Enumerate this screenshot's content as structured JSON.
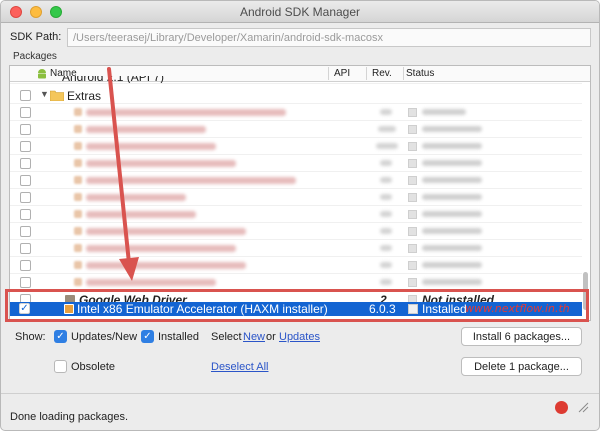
{
  "window": {
    "title": "Android SDK Manager"
  },
  "sdk_path": {
    "label": "SDK Path:",
    "value": "/Users/teerasej/Library/Developer/Xamarin/android-sdk-macosx"
  },
  "packages": {
    "section_label": "Packages",
    "columns": {
      "name": "Name",
      "api": "API",
      "rev": "Rev.",
      "status": "Status"
    },
    "partial_row": {
      "name": "Android 2.1 (API 7)"
    },
    "extras_row": {
      "name": "Extras"
    },
    "google_web_driver": {
      "name": "Google Web Driver",
      "api": "2",
      "status": "Not installed"
    },
    "haxm": {
      "name": "Intel x86 Emulator Accelerator (HAXM installer)",
      "rev": "6.0.3",
      "status": "Installed"
    }
  },
  "watermark": "www.nextflow.in.th",
  "controls": {
    "show_label": "Show:",
    "updates_new": "Updates/New",
    "installed": "Installed",
    "select_label": "Select",
    "new_link": "New",
    "or_label": "or",
    "updates_link": "Updates",
    "obsolete": "Obsolete",
    "deselect_all": "Deselect All",
    "install_button": "Install 6 packages...",
    "delete_button": "Delete 1 package..."
  },
  "status": {
    "text": "Done loading packages."
  },
  "colors": {
    "selection": "#1364d2",
    "annotation": "#d9534f",
    "watermark": "#e53935"
  }
}
